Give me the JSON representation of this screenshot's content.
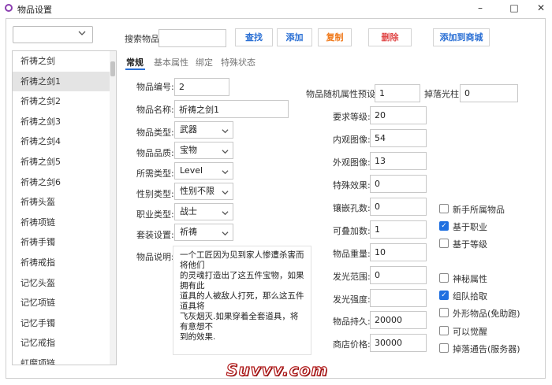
{
  "window": {
    "title": "物品设置",
    "minimize": "–",
    "maximize": "□",
    "close": "✕"
  },
  "combo": {
    "value": ""
  },
  "search": {
    "label": "搜索物品",
    "value": ""
  },
  "toolbar": {
    "find": "查找",
    "add": "添加",
    "copy": "复制",
    "delete": "删除",
    "add_to_shop": "添加到商城"
  },
  "item_list": [
    "祈祷之剑",
    "祈祷之剑1",
    "祈祷之剑2",
    "祈祷之剑3",
    "祈祷之剑4",
    "祈祷之剑5",
    "祈祷之剑6",
    "祈祷头盔",
    "祈祷项链",
    "祈祷手镯",
    "祈祷戒指",
    "记忆头盔",
    "记忆项链",
    "记忆手镯",
    "记忆戒指",
    "虹魔项链"
  ],
  "tabs": [
    "常规",
    "基本属性",
    "绑定",
    "特殊状态"
  ],
  "form": {
    "id_label": "物品编号:",
    "id": "2",
    "name_label": "物品名称:",
    "name": "祈祷之剑1",
    "type_label": "物品类型:",
    "type": "武器",
    "quality_label": "物品品质:",
    "quality": "宝物",
    "req_type_label": "所需类型:",
    "req_type": "Level",
    "gender_label": "性别类型:",
    "gender": "性别不限",
    "job_label": "职业类型:",
    "job": "战士",
    "set_label": "套装设置:",
    "set": "祈祷",
    "desc_label": "物品说明:",
    "desc": "一个工匠因为见到家人惨遭杀害而将他们\n的灵魂打造出了这五件宝物，如果拥有此\n道具的人被敌人打死，那么这五件道具将\n飞灰烟灭.如果穿着全套道具，将有意想不\n到的效果."
  },
  "attrs": {
    "random_label": "物品随机属性预设:",
    "random": "1",
    "droplight_label": "掉落光柱:",
    "droplight": "0",
    "req_level_label": "要求等级:",
    "req_level": "20",
    "inner_img_label": "内观图像:",
    "inner_img": "54",
    "outer_img_label": "外观图像:",
    "outer_img": "13",
    "effect_label": "特殊效果:",
    "effect": "0",
    "holes_label": "镶嵌孔数:",
    "holes": "0",
    "stack_label": "可叠加数:",
    "stack": "1",
    "weight_label": "物品重量:",
    "weight": "10",
    "glow_range_label": "发光范围:",
    "glow_range": "0",
    "glow_intensity_label": "发光强度:",
    "glow_intensity": "",
    "durability_label": "物品持久:",
    "durability": "20000",
    "price_label": "商店价格:",
    "price": "30000"
  },
  "checks": [
    {
      "label": "新手所属物品",
      "checked": false
    },
    {
      "label": "基于职业",
      "checked": true
    },
    {
      "label": "基于等级",
      "checked": false
    },
    {
      "label": "神秘属性",
      "checked": false
    },
    {
      "label": "组队拾取",
      "checked": true
    },
    {
      "label": "外形物品(免助跑)",
      "checked": false
    },
    {
      "label": "可以觉醒",
      "checked": false
    },
    {
      "label": "掉落通告(服务器)",
      "checked": false
    }
  ],
  "watermark": "Suvvv.com",
  "colors": {
    "accent": "#2a6fd4",
    "copy": "#f07a1c",
    "delete": "#e04848",
    "checked": "#1f6fe0",
    "watermark": "#b01818"
  }
}
